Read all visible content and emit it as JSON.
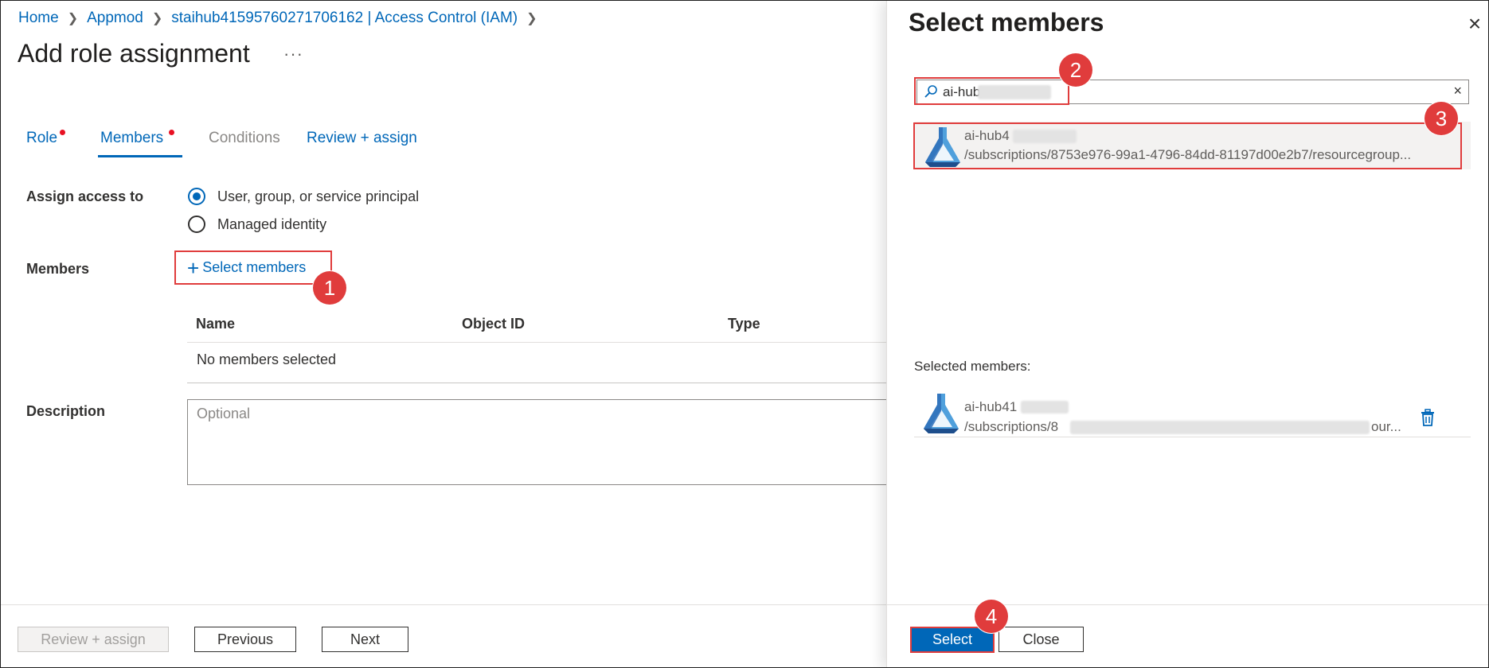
{
  "breadcrumb": [
    "Home",
    "Appmod",
    "staihub41595760271706162 | Access Control (IAM)"
  ],
  "page": {
    "title": "Add role assignment",
    "more": "···"
  },
  "tabs": [
    {
      "label": "Role"
    },
    {
      "label": "Members"
    },
    {
      "label": "Conditions"
    },
    {
      "label": "Review + assign"
    }
  ],
  "form": {
    "assign_access_label": "Assign access to",
    "option_user": "User, group, or service principal",
    "option_managed": "Managed identity",
    "members_label": "Members",
    "select_members": "Select members",
    "table_headers": [
      "Name",
      "Object ID",
      "Type"
    ],
    "empty_row": "No members selected",
    "description_label": "Description",
    "description_placeholder": "Optional"
  },
  "footer": {
    "review_assign": "Review + assign",
    "previous": "Previous",
    "next": "Next"
  },
  "panel": {
    "title": "Select members",
    "close": "×",
    "search_value": "ai-hub",
    "clear": "×",
    "result": {
      "name": "ai-hub4",
      "path": "/subscriptions/8753e976-99a1-4796-84dd-81197d00e2b7/resourcegroup..."
    },
    "selected_label": "Selected members:",
    "selected": {
      "name": "ai-hub41",
      "path_prefix": "/subscriptions/8",
      "path_suffix": "our..."
    },
    "select_btn": "Select",
    "close_btn": "Close"
  },
  "annotations": [
    "1",
    "2",
    "3",
    "4"
  ],
  "colors": {
    "accent": "#0067b8",
    "highlight": "#e03c3c",
    "required_dot": "#e81123"
  }
}
